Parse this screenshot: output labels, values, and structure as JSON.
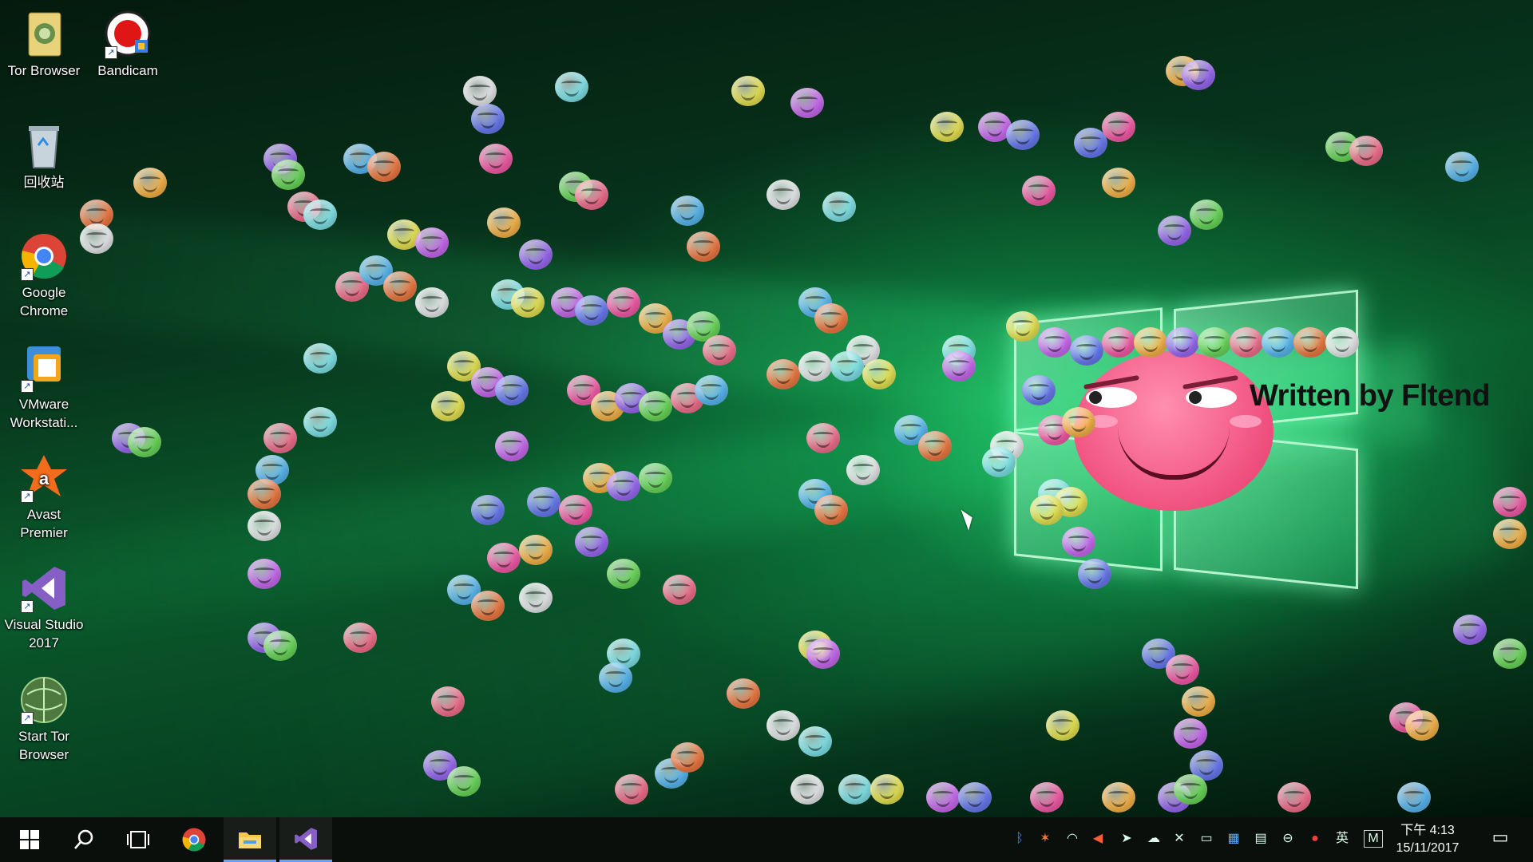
{
  "desktop": {
    "caption": "Written by Fltend",
    "icons": [
      {
        "label": "Tor Browser",
        "icon": "tor-folder-icon"
      },
      {
        "label": "Bandicam",
        "icon": "bandicam-icon"
      },
      {
        "label": "回收站",
        "icon": "recycle-bin-icon"
      },
      {
        "label": "Google Chrome",
        "icon": "chrome-icon"
      },
      {
        "label": "VMware Workstati...",
        "icon": "vmware-icon"
      },
      {
        "label": "Avast Premier",
        "icon": "avast-icon"
      },
      {
        "label": "Visual Studio 2017",
        "icon": "visual-studio-icon"
      },
      {
        "label": "Start Tor Browser",
        "icon": "tor-globe-icon"
      }
    ],
    "colors": {
      "background_dark": "#05180c",
      "background_glow": "#3cff8c",
      "face_pink": "#f0507e"
    }
  },
  "taskbar": {
    "pinned": [
      {
        "name": "start",
        "icon": "windows-start-icon"
      },
      {
        "name": "search",
        "icon": "search-icon"
      },
      {
        "name": "task-view",
        "icon": "task-view-icon"
      },
      {
        "name": "chrome",
        "icon": "chrome-icon"
      },
      {
        "name": "file-explorer",
        "icon": "folder-icon"
      },
      {
        "name": "visual-studio",
        "icon": "visual-studio-icon"
      }
    ],
    "tray_icons": [
      "bluetooth-icon",
      "app-icon",
      "wifi-icon",
      "speaker-icon",
      "send-icon",
      "cloud-icon",
      "mute-icon",
      "network-icon",
      "app-icon",
      "app-icon",
      "app-icon",
      "record-icon"
    ],
    "ime": "英",
    "ime_mode": "M",
    "time": "下午 4:13",
    "date": "15/11/2017",
    "accent": "#6aa0ff"
  }
}
